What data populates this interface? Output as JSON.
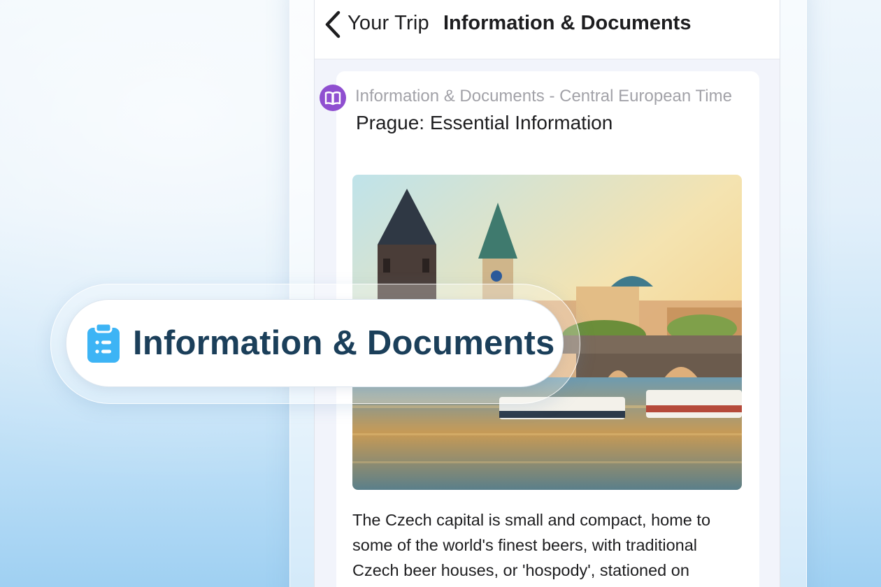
{
  "header": {
    "back_label": "Your Trip",
    "title": "Information & Documents",
    "back_icon": "chevron-left-icon"
  },
  "card": {
    "icon": "book-icon",
    "subtitle": "Information & Documents - Central European Time",
    "title": "Prague: Essential Information",
    "body": "The Czech capital is small and compact, home to some of the world's finest beers, with traditional Czech beer houses, or 'hospody', stationed on"
  },
  "chip": {
    "icon": "clipboard-icon",
    "label": "Information & Documents"
  },
  "colors": {
    "book_icon": "#8f4fd0",
    "clipboard_icon": "#3db4f5",
    "chip_text": "#1b3f5a",
    "text_primary": "#1d1d1f",
    "text_secondary": "#a2a2a8"
  }
}
